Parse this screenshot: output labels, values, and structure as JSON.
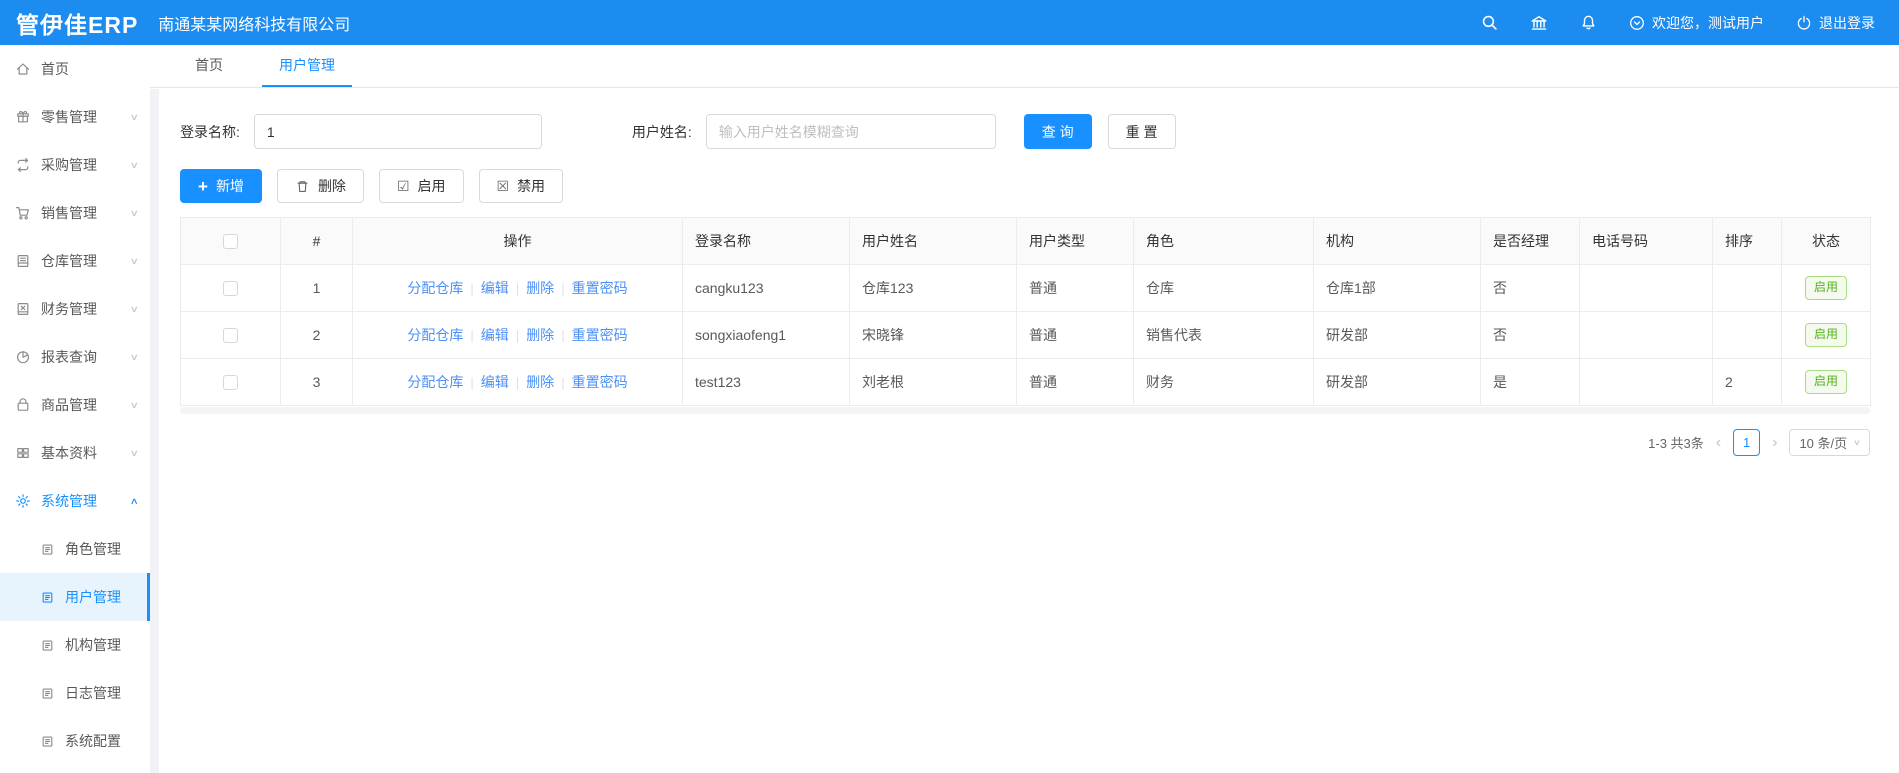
{
  "header": {
    "logo": "管伊佳ERP",
    "company": "南通某某网络科技有限公司",
    "welcome": "欢迎您，测试用户",
    "logout": "退出登录"
  },
  "tabs": [
    {
      "label": "首页"
    },
    {
      "label": "用户管理"
    }
  ],
  "sidebar": {
    "items": [
      {
        "label": "首页"
      },
      {
        "label": "零售管理"
      },
      {
        "label": "采购管理"
      },
      {
        "label": "销售管理"
      },
      {
        "label": "仓库管理"
      },
      {
        "label": "财务管理"
      },
      {
        "label": "报表查询"
      },
      {
        "label": "商品管理"
      },
      {
        "label": "基本资料"
      },
      {
        "label": "系统管理"
      },
      {
        "label": "角色管理"
      },
      {
        "label": "用户管理"
      },
      {
        "label": "机构管理"
      },
      {
        "label": "日志管理"
      },
      {
        "label": "系统配置"
      }
    ]
  },
  "search": {
    "login_label": "登录名称:",
    "login_value": "1",
    "name_label": "用户姓名:",
    "name_placeholder": "输入用户姓名模糊查询",
    "query_label": "查 询",
    "reset_label": "重 置"
  },
  "actions": {
    "add": "新增",
    "delete": "删除",
    "enable": "启用",
    "disable": "禁用"
  },
  "table": {
    "columns": [
      "#",
      "操作",
      "登录名称",
      "用户姓名",
      "用户类型",
      "角色",
      "机构",
      "是否经理",
      "电话号码",
      "排序",
      "状态"
    ],
    "operations": [
      "分配仓库",
      "编辑",
      "删除",
      "重置密码"
    ],
    "op_separator": "|",
    "rows": [
      {
        "index": "1",
        "login": "cangku123",
        "name": "仓库123",
        "type": "普通",
        "role": "仓库",
        "org": "仓库1部",
        "manager": "否",
        "phone": "",
        "sort": "",
        "status": "启用"
      },
      {
        "index": "2",
        "login": "songxiaofeng1",
        "name": "宋晓锋",
        "type": "普通",
        "role": "销售代表",
        "org": "研发部",
        "manager": "否",
        "phone": "",
        "sort": "",
        "status": "启用"
      },
      {
        "index": "3",
        "login": "test123",
        "name": "刘老根",
        "type": "普通",
        "role": "财务",
        "org": "研发部",
        "manager": "是",
        "phone": "",
        "sort": "2",
        "status": "启用"
      }
    ]
  },
  "pagination": {
    "total": "1-3 共3条",
    "prev": "‹",
    "next": "›",
    "page": "1",
    "page_size": "10 条/页"
  },
  "icons": {
    "chevron_down": "∨",
    "chevron_up": "∧",
    "plus": "+",
    "box_check": "☑",
    "box_x": "☒"
  },
  "colors": {
    "primary": "#1d8cf0",
    "accent": "#1890ff",
    "status_green": "#55b11f"
  }
}
